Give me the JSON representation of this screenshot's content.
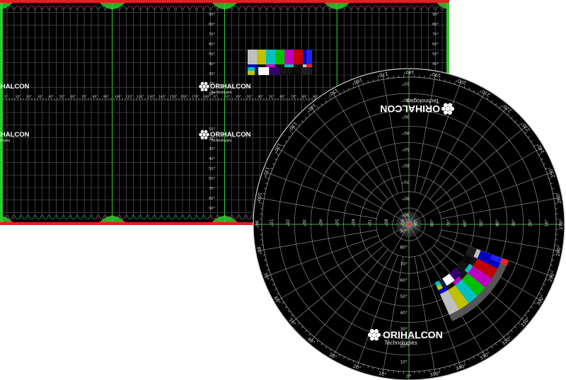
{
  "brand": {
    "name": "ORIHALCON",
    "tagline": "Technologies"
  },
  "colors": {
    "background": "#000000",
    "grid": "#9a9a9a",
    "center_line": "#33dd33",
    "edge_green": "#2ecc2e",
    "edge_red": "#dd2222",
    "bars_top": [
      "#c0c0c0",
      "#c0c000",
      "#00c0c0",
      "#00c000",
      "#c000c0",
      "#c00000",
      "#0000c0"
    ],
    "bars_mid": [
      "#0000c0",
      "#131313",
      "#c000c0",
      "#131313",
      "#00c0c0",
      "#131313",
      "#c0c0c0"
    ],
    "bars_bottom": [
      "#00214c",
      "#ffffff",
      "#32006a",
      "#131313",
      "#090909",
      "#1d1d1d"
    ]
  },
  "flat_projection": {
    "azimuth_labels": [
      "0°",
      "10°",
      "20°",
      "30°",
      "40°",
      "50°",
      "60°",
      "70°",
      "80°",
      "90°",
      "100°",
      "110°",
      "120°",
      "130°",
      "140°",
      "150°",
      "160°",
      "170°",
      "180°"
    ],
    "elevation_labels": [
      "90°",
      "80°",
      "70°",
      "60°",
      "50°",
      "40°",
      "30°",
      "20°",
      "10°"
    ]
  },
  "dome_projection": {
    "azimuth_labels": [
      "0°",
      "10°",
      "20°",
      "30°",
      "40°",
      "50°",
      "60°",
      "70°",
      "80°",
      "90°",
      "100°",
      "110°",
      "120°",
      "130°",
      "140°",
      "150°",
      "160°",
      "170°",
      "180°",
      "190°",
      "200°",
      "210°",
      "220°",
      "230°",
      "240°",
      "250°",
      "260°",
      "270°",
      "280°",
      "290°",
      "300°",
      "310°",
      "320°",
      "330°",
      "340°",
      "350°"
    ],
    "radial_labels": [
      "90°",
      "80°",
      "70°",
      "60°",
      "50°",
      "40°",
      "30°",
      "20°",
      "10°"
    ]
  }
}
